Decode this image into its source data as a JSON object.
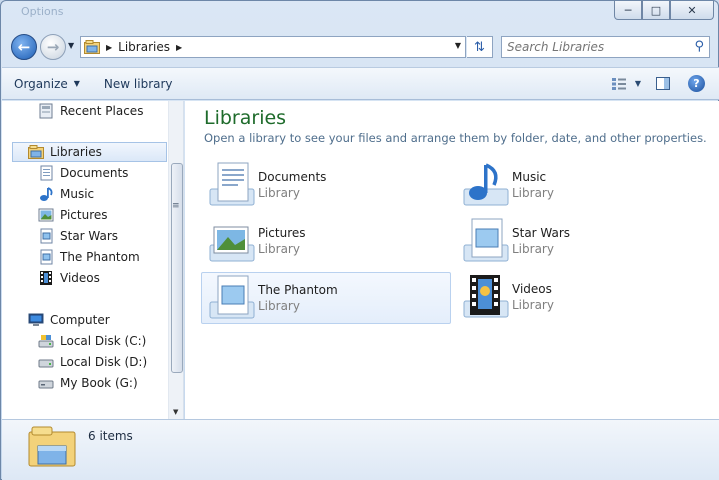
{
  "window": {
    "ghost_title": "Options",
    "minimize": "─",
    "maximize": "□",
    "close": "✕"
  },
  "address": {
    "crumb": "Libraries",
    "search_placeholder": "Search Libraries"
  },
  "toolbar": {
    "organize": "Organize",
    "new_library": "New library"
  },
  "nav": {
    "items": [
      {
        "label": "Recent Places",
        "icon": "recent-places-icon"
      },
      {
        "label": "Libraries",
        "icon": "libraries-icon"
      },
      {
        "label": "Documents",
        "icon": "documents-icon"
      },
      {
        "label": "Music",
        "icon": "music-icon"
      },
      {
        "label": "Pictures",
        "icon": "pictures-icon"
      },
      {
        "label": "Star Wars",
        "icon": "library-icon"
      },
      {
        "label": "The Phantom",
        "icon": "library-icon"
      },
      {
        "label": "Videos",
        "icon": "videos-icon"
      },
      {
        "label": "Computer",
        "icon": "computer-icon"
      },
      {
        "label": "Local Disk (C:)",
        "icon": "disk-icon"
      },
      {
        "label": "Local Disk (D:)",
        "icon": "disk-icon"
      },
      {
        "label": "My Book (G:)",
        "icon": "disk-icon"
      }
    ]
  },
  "content": {
    "title": "Libraries",
    "subtitle": "Open a library to see your files and arrange them by folder, date, and other properties.",
    "libraries": [
      {
        "name": "Documents",
        "type": "Library"
      },
      {
        "name": "Music",
        "type": "Library"
      },
      {
        "name": "Pictures",
        "type": "Library"
      },
      {
        "name": "Star Wars",
        "type": "Library"
      },
      {
        "name": "The Phantom",
        "type": "Library"
      },
      {
        "name": "Videos",
        "type": "Library"
      }
    ]
  },
  "details": {
    "count": "6 items"
  },
  "colors": {
    "title_green": "#1e6b2b",
    "accent_blue": "#2a5da8"
  }
}
